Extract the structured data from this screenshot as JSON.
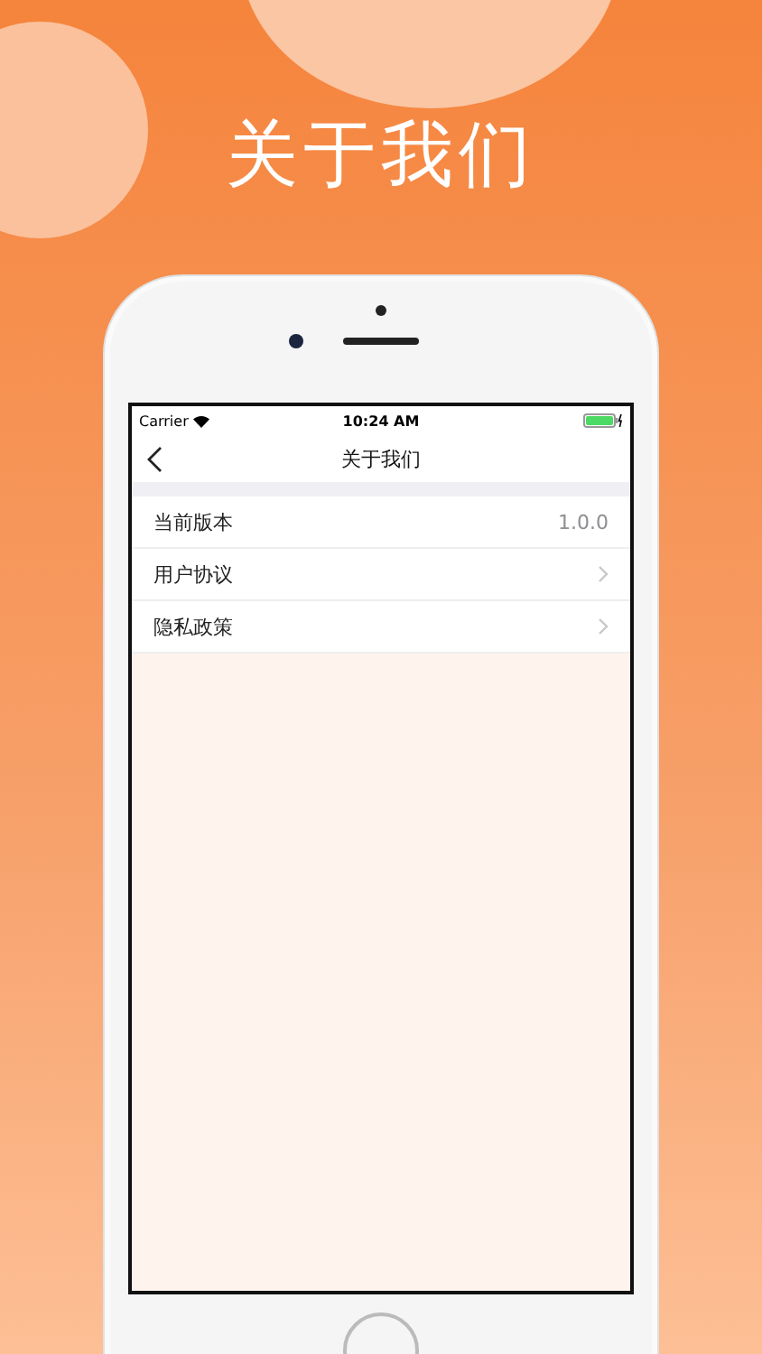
{
  "headline": "关于我们",
  "status_bar": {
    "carrier": "Carrier",
    "time": "10:24 AM"
  },
  "nav": {
    "title": "关于我们"
  },
  "rows": [
    {
      "kind": "value",
      "label": "当前版本",
      "value": "1.0.0"
    },
    {
      "kind": "link",
      "label": "用户协议"
    },
    {
      "kind": "link",
      "label": "隐私政策"
    }
  ]
}
